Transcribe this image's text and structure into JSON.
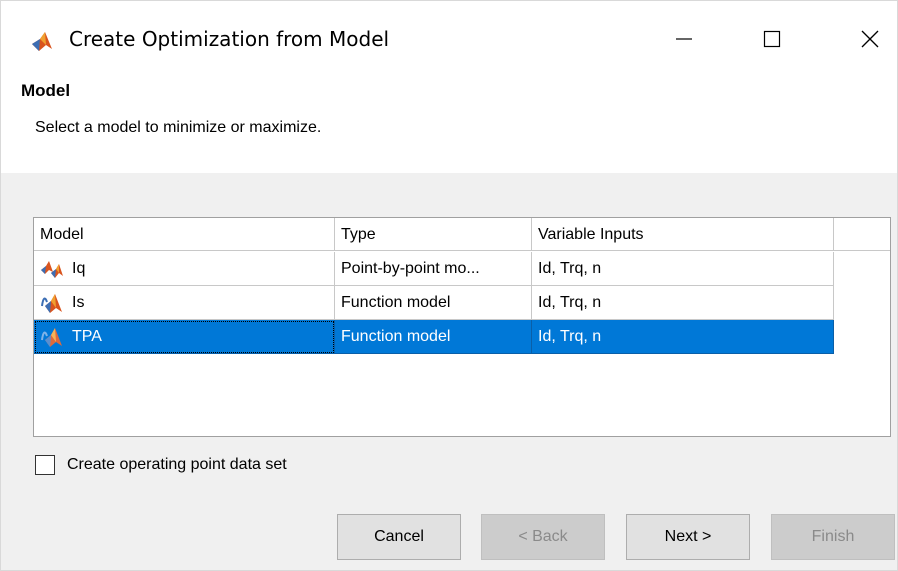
{
  "window": {
    "title": "Create Optimization from Model",
    "icon": "matlab-icon"
  },
  "header": {
    "title": "Model",
    "subtitle": "Select a model to minimize or maximize."
  },
  "table": {
    "columns": [
      "Model",
      "Type",
      "Variable Inputs"
    ],
    "rows": [
      {
        "model": "Iq",
        "type": "Point-by-point mo...",
        "inputs": "Id, Trq, n",
        "icon": "point-by-point-model-icon",
        "selected": false
      },
      {
        "model": "Is",
        "type": "Function model",
        "inputs": "Id, Trq, n",
        "icon": "function-model-icon",
        "selected": false
      },
      {
        "model": "TPA",
        "type": "Function model",
        "inputs": "Id, Trq, n",
        "icon": "function-model-icon",
        "selected": true
      }
    ]
  },
  "checkbox": {
    "label": "Create operating point data set",
    "checked": false
  },
  "buttons": {
    "cancel": "Cancel",
    "back": "< Back",
    "next": "Next >",
    "finish": "Finish"
  },
  "colors": {
    "selection": "#0078d7",
    "window_bg": "#f0f0f0"
  }
}
